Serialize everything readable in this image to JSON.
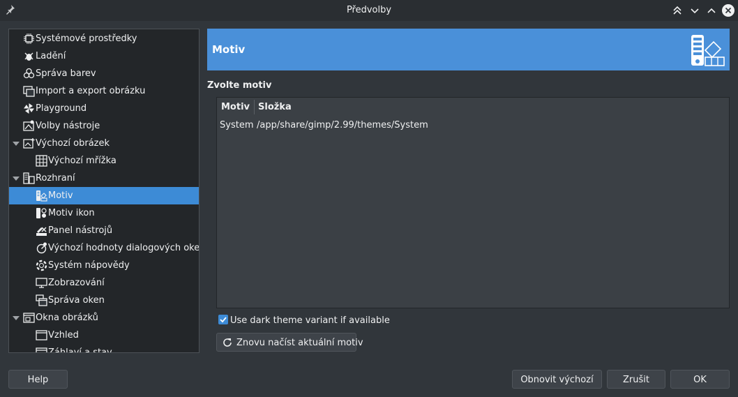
{
  "window": {
    "title": "Předvolby"
  },
  "sidebar": {
    "items": [
      {
        "label": "Systémové prostředky",
        "icon": "chip-icon",
        "indent": 1
      },
      {
        "label": "Ladění",
        "icon": "bug-icon",
        "indent": 1
      },
      {
        "label": "Správa barev",
        "icon": "color-management-icon",
        "indent": 1
      },
      {
        "label": "Import a export obrázku",
        "icon": "import-export-icon",
        "indent": 1
      },
      {
        "label": "Playground",
        "icon": "pinwheel-icon",
        "indent": 1
      },
      {
        "label": "Volby nástroje",
        "icon": "tool-options-icon",
        "indent": 1
      },
      {
        "label": "Výchozí obrázek",
        "icon": "new-image-icon",
        "indent": 1,
        "expander": true
      },
      {
        "label": "Výchozí mřížka",
        "icon": "grid-icon",
        "indent": 2
      },
      {
        "label": "Rozhraní",
        "icon": "interface-icon",
        "indent": 1,
        "expander": true
      },
      {
        "label": "Motiv",
        "icon": "theme-icon",
        "indent": 2,
        "selected": true
      },
      {
        "label": "Motiv ikon",
        "icon": "icon-theme-icon",
        "indent": 2
      },
      {
        "label": "Panel nástrojů",
        "icon": "toolbox-icon",
        "indent": 2
      },
      {
        "label": "Výchozí hodnoty dialogových oken",
        "icon": "dialog-defaults-icon",
        "indent": 2
      },
      {
        "label": "Systém nápovědy",
        "icon": "help-system-icon",
        "indent": 2
      },
      {
        "label": "Zobrazování",
        "icon": "display-icon",
        "indent": 2
      },
      {
        "label": "Správa oken",
        "icon": "window-management-icon",
        "indent": 2
      },
      {
        "label": "Okna obrázků",
        "icon": "image-windows-icon",
        "indent": 1,
        "expander": true
      },
      {
        "label": "Vzhled",
        "icon": "appearance-icon",
        "indent": 2
      },
      {
        "label": "Záhlaví a stav",
        "icon": "title-status-icon",
        "indent": 2
      }
    ]
  },
  "banner": {
    "title": "Motiv",
    "icon": "theme-palette-icon"
  },
  "section": {
    "title": "Zvolte motiv"
  },
  "table": {
    "headers": [
      "Motiv",
      "Složka"
    ],
    "rows": [
      [
        "System",
        "/app/share/gimp/2.99/themes/System"
      ]
    ]
  },
  "dark_variant": {
    "label": "Use dark theme variant if available",
    "checked": true
  },
  "reload_button": {
    "label": "Znovu načíst aktuální motiv"
  },
  "footer": {
    "help": "Help",
    "reset": "Obnovit výchozí",
    "cancel": "Zrušit",
    "ok": "OK"
  },
  "colors": {
    "accent": "#3d8bd6",
    "banner": "#4a90d9",
    "background": "#31363b",
    "panel": "#232629"
  }
}
